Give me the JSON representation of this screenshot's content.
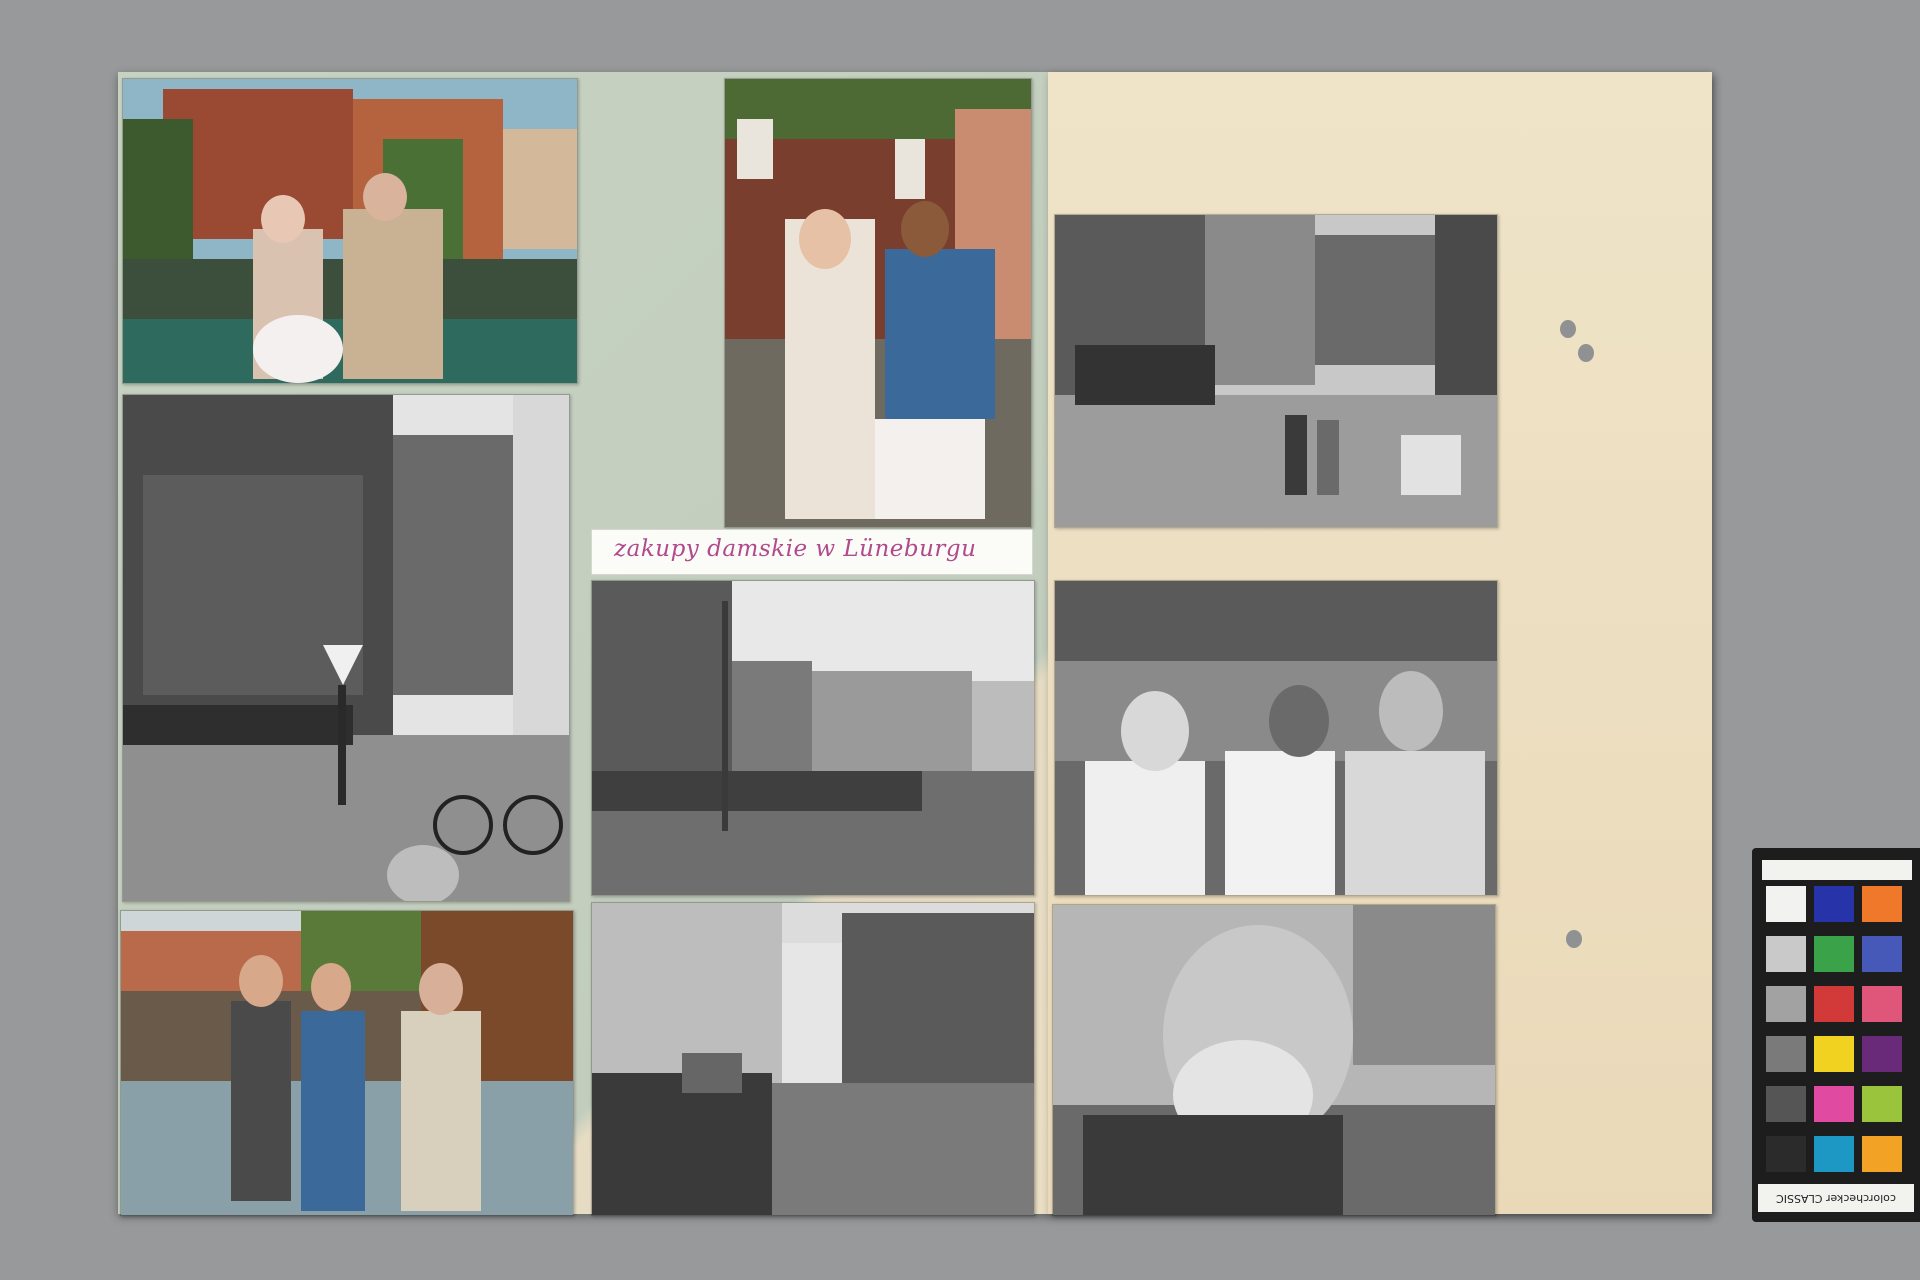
{
  "page": {
    "caption": "zakupy damskie w Lüneburgu"
  },
  "color_checker": {
    "label": "colorchecker CLASSIC",
    "swatches": [
      "#f2f2f0",
      "#2733a8",
      "#f0782a",
      "#c9c9c9",
      "#3aa34a",
      "#4659b8",
      "#a2a2a2",
      "#d23a3a",
      "#e0557a",
      "#7a7a7a",
      "#f2d221",
      "#6a2a7a",
      "#555555",
      "#e04aa0",
      "#9ac43c",
      "#2b2b2b",
      "#1d97c4",
      "#f2a224"
    ]
  }
}
